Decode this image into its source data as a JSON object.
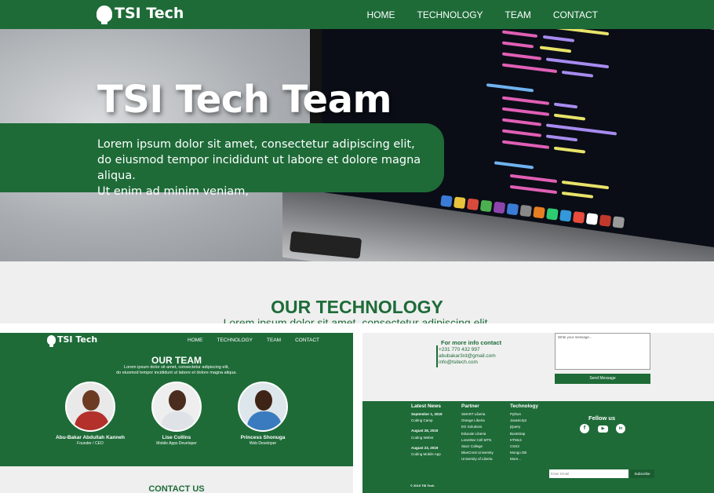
{
  "brand": {
    "name": "TSI Tech",
    "color": "#1e6b38"
  },
  "nav": [
    "HOME",
    "TECHNOLOGY",
    "TEAM",
    "CONTACT"
  ],
  "hero": {
    "title": "TSI Tech Team",
    "lines": [
      "Lorem ipsum dolor sit amet, consectetur adipiscing elit,",
      "do eiusmod tempor incididunt ut labore et dolore magna aliqua.",
      "Ut enim ad minim veniam,"
    ]
  },
  "technology": {
    "title": "OUR TECHNOLOGY",
    "subtitle": "Lorem ipsum dolor sit amet, consectetur adipiscing elit,"
  },
  "team": {
    "title": "OUR TEAM",
    "subtitle_lines": [
      "Lorem ipsum dolor sit amet, consectetur adipiscing elit,",
      "do eiusmod tempor incididunt ut labore et dolore magna aliqua."
    ],
    "members": [
      {
        "name": "Abu-Bakar Abdullah Kanneh",
        "role": "Founder / CEO"
      },
      {
        "name": "Lise Collins",
        "role": "Mobile Apps Developer"
      },
      {
        "name": "Princess Shonuga",
        "role": "Web Developer"
      }
    ]
  },
  "contact": {
    "title": "CONTACT US",
    "info_title": "For more info contact",
    "phone": "+231 770 432 997",
    "email1": "abubakar3rd@gmail.com",
    "email2": "info@tsitech.com",
    "message_placeholder": "Write your message...",
    "send_label": "Send Message"
  },
  "footer": {
    "news": {
      "title": "Latest News",
      "items": [
        {
          "date": "September 1, 2019",
          "text": "Coding Camp"
        },
        {
          "date": "August 28, 2019",
          "text": "Coding Webst"
        },
        {
          "date": "August 23, 2019",
          "text": "Coding Mobile App"
        }
      ]
    },
    "partner": {
      "title": "Partner",
      "items": [
        "SMART Liberia",
        "Orange Liberia",
        "EG Solutions",
        "Educate Liberia",
        "LoneStar Cell MTN",
        "Starz College",
        "BlueCrest University",
        "University of Liberia"
      ]
    },
    "technology": {
      "title": "Technology",
      "items": [
        "Python",
        "JavaScript",
        "jQuery",
        "Bootstrap",
        "HTML5",
        "CSS3",
        "Mongo DB",
        "More..."
      ]
    },
    "follow_title": "Fellow us",
    "social": [
      "facebook-icon",
      "youtube-icon",
      "linkedin-icon"
    ],
    "email_placeholder": "Enter Email",
    "subscribe_label": "Subscribe",
    "copyright": "© 2019 TSI Tech"
  }
}
